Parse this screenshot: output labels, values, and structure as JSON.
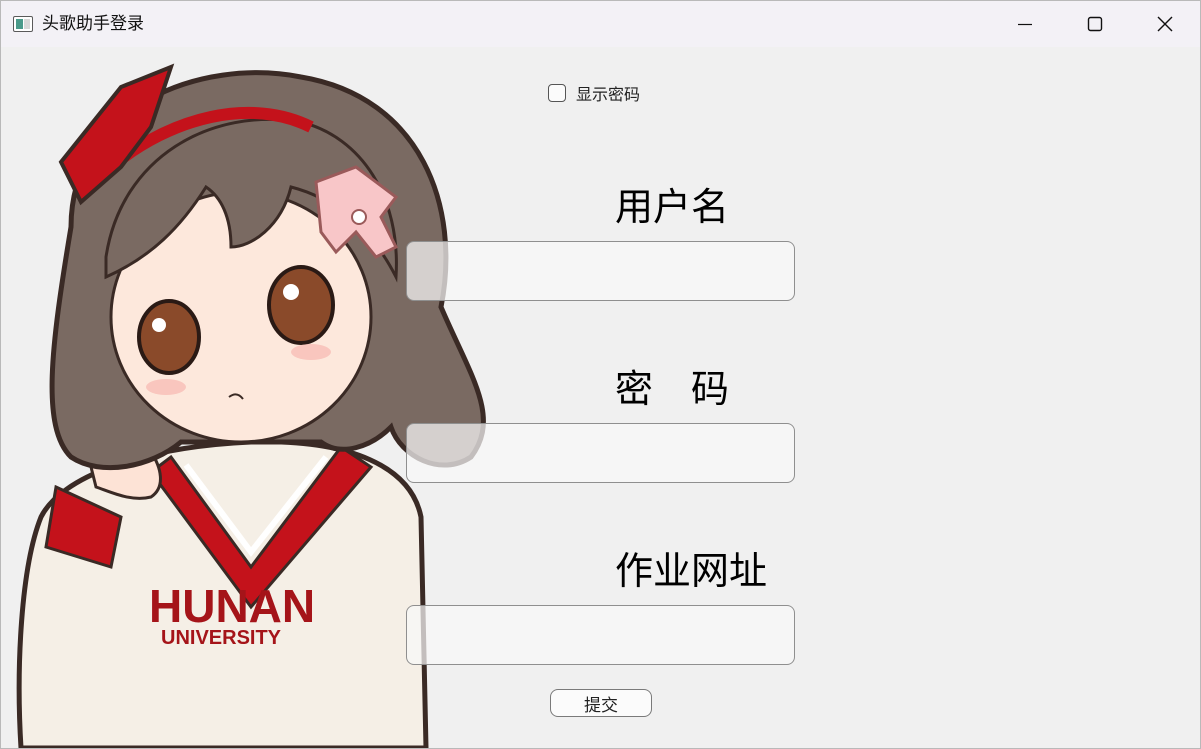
{
  "window": {
    "title": "头歌助手登录",
    "icon": "app-window-icon",
    "controls": {
      "minimize": "minimize-icon",
      "maximize": "maximize-icon",
      "close": "close-icon"
    }
  },
  "illustration": {
    "subject": "anime-girl-character",
    "shirt_text_line1": "HUNAN",
    "shirt_text_line2": "UNIVERSITY",
    "colors": {
      "hair": "#7a6a62",
      "accent": "#c4121b",
      "shirt": "#f5efe6"
    }
  },
  "form": {
    "show_password_label": "显示密码",
    "show_password_checked": false,
    "username_label": "用户名",
    "username_value": "",
    "password_label": "密　码",
    "password_value": "",
    "homework_url_label": "作业网址",
    "homework_url_value": "",
    "submit_label": "提交"
  }
}
